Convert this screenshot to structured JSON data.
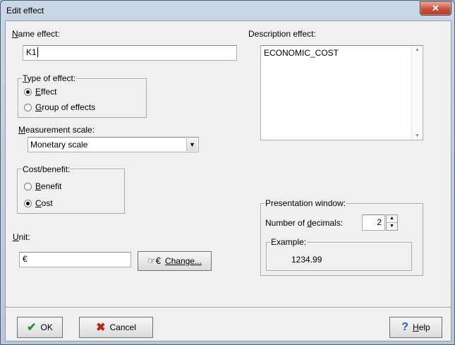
{
  "window": {
    "title": "Edit effect",
    "close_label": "✕"
  },
  "name_effect": {
    "label_mnemonic": "N",
    "label_rest": "ame effect:",
    "value": "K1"
  },
  "description_effect": {
    "label": "Description effect:",
    "value": "ECONOMIC_COST"
  },
  "type_of_effect": {
    "title_mnemonic": "T",
    "title_rest": "ype of  effect:",
    "options": [
      {
        "mnemonic": "E",
        "rest": "ffect",
        "selected": true
      },
      {
        "mnemonic": "G",
        "rest": "roup of effects",
        "selected": false
      }
    ]
  },
  "measurement_scale": {
    "label_mnemonic": "M",
    "label_rest": "easurement scale:",
    "selected": "Monetary scale"
  },
  "cost_benefit": {
    "title": "Cost/benefit:",
    "options": [
      {
        "mnemonic": "B",
        "rest": "enefit",
        "selected": false
      },
      {
        "mnemonic": "C",
        "rest": "ost",
        "selected": true
      }
    ]
  },
  "unit": {
    "label_mnemonic": "U",
    "label_rest": "nit:",
    "value": "€",
    "change_label_mnemonic": "C",
    "change_label_rest": "hange...",
    "change_icon_text": "€"
  },
  "presentation_window": {
    "title": "Presentation window:",
    "decimals_label_pre": "Number of ",
    "decimals_label_mnemonic": "d",
    "decimals_label_rest": "ecimals:",
    "decimals_value": "2",
    "example_title": "Example:",
    "example_value": "1234.99"
  },
  "footer": {
    "ok_label": "OK",
    "cancel_label": "Cancel",
    "help_mnemonic": "H",
    "help_rest": "elp",
    "help_icon": "?"
  },
  "colors": {
    "ok_check": "#2e8b2e",
    "cancel_x": "#c0261a",
    "help_icon": "#1f5fbf"
  }
}
